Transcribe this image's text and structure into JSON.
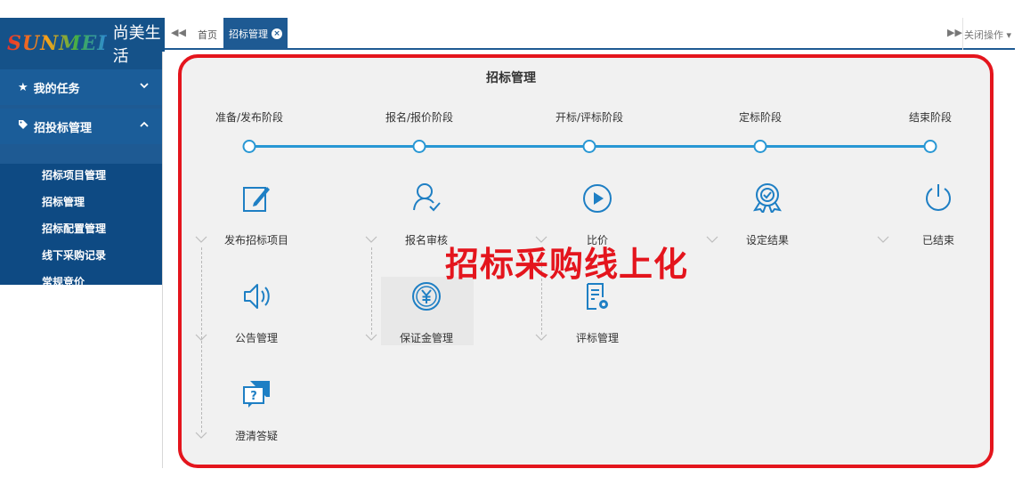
{
  "sidebar": {
    "logo_brand": "SUNMEI",
    "logo_cn": "尚美生活",
    "groups": [
      {
        "label": "我的任务",
        "icon": "star-icon",
        "expanded": false
      },
      {
        "label": "招投标管理",
        "icon": "tag-icon",
        "expanded": true
      }
    ],
    "sub_items": [
      "招标项目管理",
      "招标管理",
      "招标配置管理",
      "线下采购记录",
      "常规竞价"
    ]
  },
  "tabs": {
    "home": "首页",
    "active": "招标管理",
    "close_ops": "关闭操作"
  },
  "page": {
    "title": "招标管理",
    "stages": [
      "准备/发布阶段",
      "报名/报价阶段",
      "开标/评标阶段",
      "定标阶段",
      "结束阶段"
    ],
    "steps": [
      {
        "label": "发布招标项目",
        "icon": "edit-icon"
      },
      {
        "label": "报名审核",
        "icon": "user-check-icon"
      },
      {
        "label": "比价",
        "icon": "play-circle-icon"
      },
      {
        "label": "设定结果",
        "icon": "award-icon"
      },
      {
        "label": "已结束",
        "icon": "power-icon"
      },
      {
        "label": "公告管理",
        "icon": "speaker-icon"
      },
      {
        "label": "保证金管理",
        "icon": "yuan-circle-icon"
      },
      {
        "label": "评标管理",
        "icon": "document-settings-icon"
      },
      {
        "label": "澄清答疑",
        "icon": "question-chat-icon"
      }
    ],
    "overlay_text": "招标采购线上化"
  },
  "colors": {
    "sidebar_bg": "#1e5a93",
    "accent_blue": "#2897d4",
    "highlight_red": "#e4151d"
  }
}
